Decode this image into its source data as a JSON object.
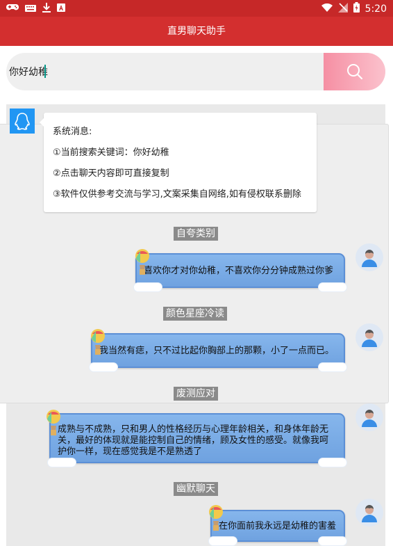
{
  "status_bar": {
    "time": "5:20",
    "left_icons": [
      "gamepad-icon",
      "keyboard-icon",
      "download-icon",
      "letter-a-icon"
    ],
    "right_icons": [
      "wifi-icon",
      "no-signal-icon",
      "battery-icon"
    ]
  },
  "app_bar": {
    "title": "直男聊天助手"
  },
  "search": {
    "value": "你好幼稚",
    "button_icon": "search-icon"
  },
  "system_message": {
    "lines": [
      "系统消息:",
      "①当前搜索关键词：你好幼稚",
      "②点击聊天内容即可直接复制",
      "③软件仅供参考交流与学习,文案采集自网络,如有侵权联系删除"
    ]
  },
  "chat": {
    "categories": [
      {
        "label": "自夸类别",
        "message": "喜欢你才对你幼稚，不喜欢你分分钟成熟过你爹"
      },
      {
        "label": "颜色星座冷读",
        "message": "我当然有痣，只不过比起你胸部上的那颗，小了一点而已。"
      },
      {
        "label": "废测应对",
        "message": "成熟与不成熟，只和男人的性格经历与心理年龄相关，和身体年龄无关，最好的体现就是能控制自己的情绪，顾及女性的感受。就像我呵护你一样，现在感觉我是不是熟透了"
      },
      {
        "label": "幽默聊天",
        "message": "在你面前我永远是幼稚的害羞"
      }
    ]
  },
  "colors": {
    "status_bar": "#c62828",
    "app_bar": "#d32f2f",
    "bubble": "#78aae6",
    "tag": "#8a8a8a",
    "search_button": "#f7a1b2",
    "system_avatar": "#2196f3"
  }
}
